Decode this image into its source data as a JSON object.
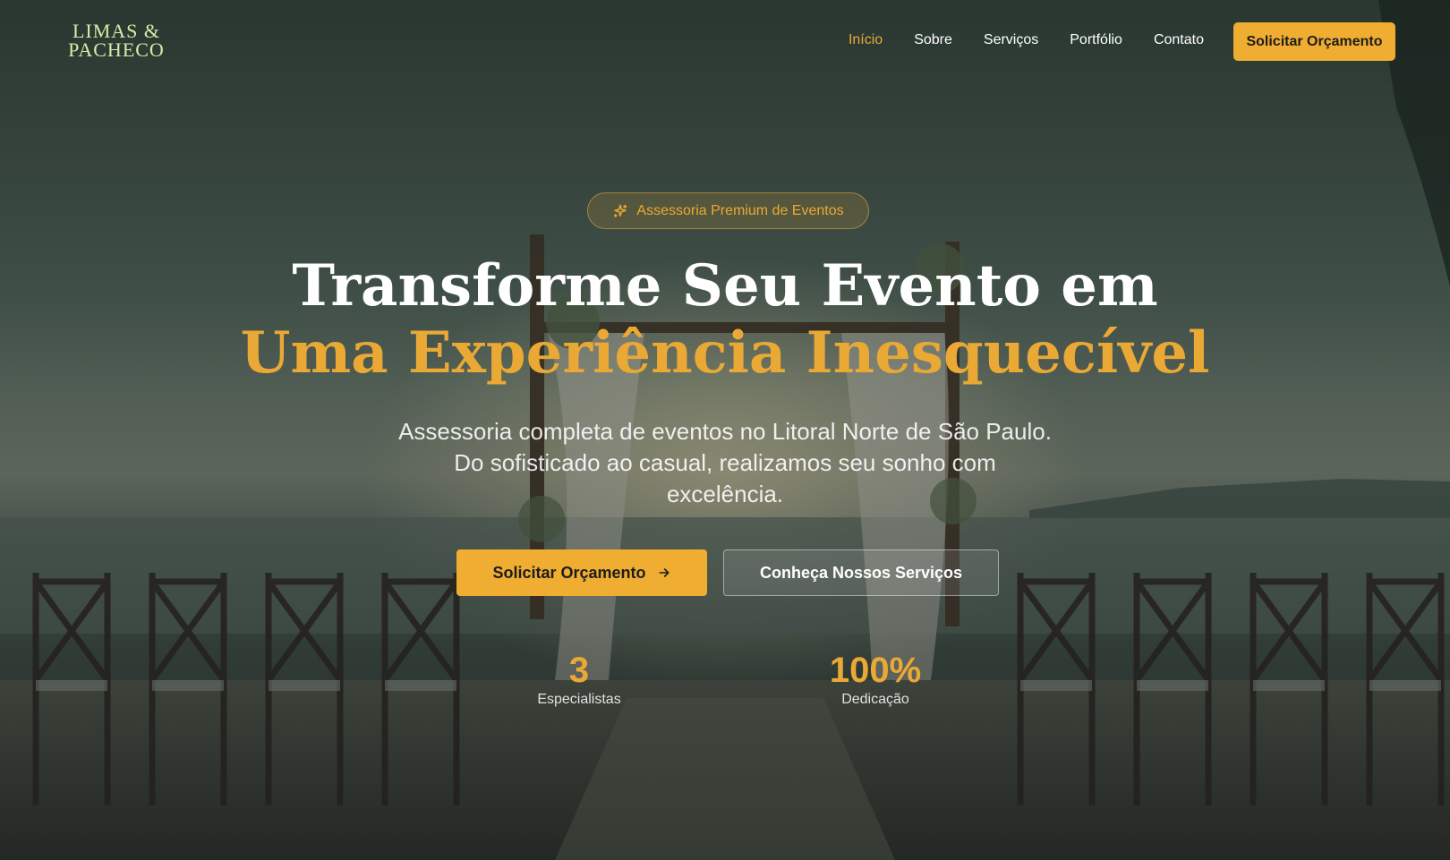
{
  "header": {
    "logo_line1": "LIMAS &",
    "logo_line2": "PACHECO",
    "nav": [
      {
        "label": "Início",
        "active": true
      },
      {
        "label": "Sobre",
        "active": false
      },
      {
        "label": "Serviços",
        "active": false
      },
      {
        "label": "Portfólio",
        "active": false
      },
      {
        "label": "Contato",
        "active": false
      }
    ],
    "cta_label": "Solicitar Orçamento"
  },
  "hero": {
    "badge_label": "Assessoria Premium de Eventos",
    "badge_icon": "sparkle-icon",
    "title_line1": "Transforme Seu Evento em",
    "title_line2": "Uma Experiência Inesquecível",
    "subtitle": "Assessoria completa de eventos no Litoral Norte de São Paulo. Do sofisticado ao casual, realizamos seu sonho com excelência.",
    "primary_button": "Solicitar Orçamento",
    "primary_button_icon": "arrow-right-icon",
    "secondary_button": "Conheça Nossos Serviços",
    "stats": [
      {
        "value": "3",
        "label": "Especialistas"
      },
      {
        "value": "100%",
        "label": "Dedicação"
      }
    ]
  },
  "colors": {
    "accent": "#eaa935",
    "button": "#efad31",
    "logo": "#dbe9a8"
  }
}
